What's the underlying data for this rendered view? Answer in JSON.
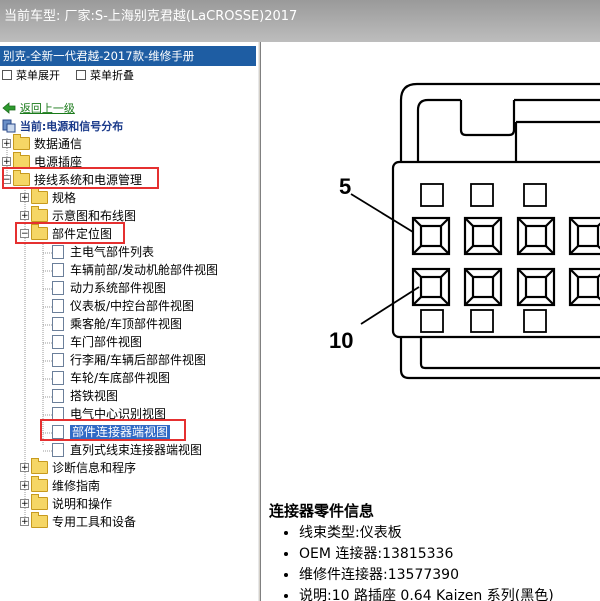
{
  "window": {
    "title": "当前车型:  厂家:S-上海别克君越(LaCROSSE)2017"
  },
  "sidebar": {
    "manual_title": "别克-全新一代君越-2017款-维修手册",
    "expand_menu": "菜单展开",
    "collapse_menu": "菜单折叠",
    "back_link": "返回上一级",
    "current": "当前:电源和信号分布",
    "tree": [
      {
        "label": "数据通信",
        "level": 0,
        "type": "folder",
        "expander": "+"
      },
      {
        "label": "电源插座",
        "level": 0,
        "type": "folder",
        "expander": "+"
      },
      {
        "label": "接线系统和电源管理",
        "level": 0,
        "type": "folder",
        "expander": "-",
        "highlighted": true
      },
      {
        "label": "规格",
        "level": 1,
        "type": "folder",
        "expander": "+"
      },
      {
        "label": "示意图和布线图",
        "level": 1,
        "type": "folder",
        "expander": "+"
      },
      {
        "label": "部件定位图",
        "level": 1,
        "type": "folder",
        "expander": "-",
        "highlighted": true
      },
      {
        "label": "主电气部件列表",
        "level": 2,
        "type": "page"
      },
      {
        "label": "车辆前部/发动机舱部件视图",
        "level": 2,
        "type": "page"
      },
      {
        "label": "动力系统部件视图",
        "level": 2,
        "type": "page"
      },
      {
        "label": "仪表板/中控台部件视图",
        "level": 2,
        "type": "page"
      },
      {
        "label": "乘客舱/车顶部件视图",
        "level": 2,
        "type": "page"
      },
      {
        "label": "车门部件视图",
        "level": 2,
        "type": "page"
      },
      {
        "label": "行李厢/车辆后部部件视图",
        "level": 2,
        "type": "page"
      },
      {
        "label": "车轮/车底部件视图",
        "level": 2,
        "type": "page"
      },
      {
        "label": "搭铁视图",
        "level": 2,
        "type": "page"
      },
      {
        "label": "电气中心识别视图",
        "level": 2,
        "type": "page"
      },
      {
        "label": "部件连接器端视图",
        "level": 2,
        "type": "page",
        "highlighted": true,
        "selected": true
      },
      {
        "label": "直列式线束连接器端视图",
        "level": 2,
        "type": "page"
      },
      {
        "label": "诊断信息和程序",
        "level": 1,
        "type": "folder",
        "expander": "+"
      },
      {
        "label": "维修指南",
        "level": 1,
        "type": "folder",
        "expander": "+"
      },
      {
        "label": "说明和操作",
        "level": 1,
        "type": "folder",
        "expander": "+"
      },
      {
        "label": "专用工具和设备",
        "level": 1,
        "type": "folder",
        "expander": "+"
      }
    ]
  },
  "connector_diagram": {
    "callouts": [
      "5",
      "10"
    ]
  },
  "info": {
    "title": "连接器零件信息",
    "items": [
      "线束类型:仪表板",
      "OEM 连接器:13815336",
      "维修件连接器:13577390",
      "说明:10 路插座 0.64 Kaizen 系列(黑色)"
    ]
  },
  "colors": {
    "title_bar": "#a8a8a8",
    "manual_title_bg": "#1e5da3",
    "highlight": "#e53030",
    "folder": "#f5d665"
  }
}
